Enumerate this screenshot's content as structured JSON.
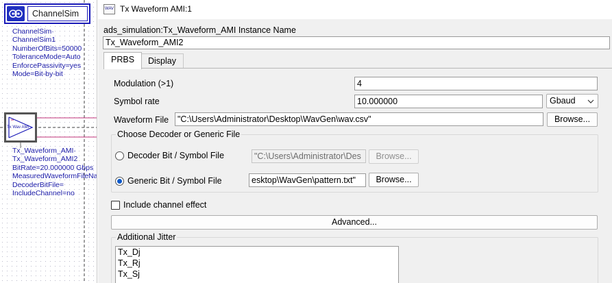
{
  "schematic": {
    "channelsim": {
      "label": "ChannelSim",
      "params": [
        "ChannelSim·",
        "ChannelSim1",
        "NumberOfBits=50000",
        "ToleranceMode=Auto",
        "EnforcePassivity=yes",
        "Mode=Bit-by-bit"
      ]
    },
    "tx_block": {
      "symbol_text": "Tx Wav AMI",
      "params": [
        "Tx_Waveform_AMI·",
        "Tx_Waveform_AMI2",
        "BitRate=20.000000 Gbps",
        "MeasuredWaveformFileNa",
        "DecoderBitFile=",
        "IncludeChannel=no"
      ]
    }
  },
  "dialog": {
    "title": "Tx Waveform AMI:1",
    "instance_label": "ads_simulation:Tx_Waveform_AMI Instance Name",
    "instance_name": "Tx_Waveform_AMI2",
    "tabs": [
      {
        "label": "PRBS",
        "active": true
      },
      {
        "label": "Display",
        "active": false
      }
    ],
    "prbs": {
      "modulation": {
        "label": "Modulation (>1)",
        "value": "4"
      },
      "symbol_rate": {
        "label": "Symbol rate",
        "value": "10.000000",
        "unit": "Gbaud"
      },
      "waveform_file": {
        "label": "Waveform File",
        "value": "\"C:\\Users\\Administrator\\Desktop\\WavGen\\wav.csv\"",
        "browse": "Browse..."
      },
      "decoder_group": {
        "title": "Choose Decoder or Generic File",
        "decoder": {
          "label": "Decoder Bit / Symbol File",
          "value": "\"C:\\Users\\Administrator\\Des",
          "browse": "Browse...",
          "checked": false
        },
        "generic": {
          "label": "Generic Bit / Symbol File",
          "value": "esktop\\WavGen\\pattern.txt\"",
          "browse": "Browse...",
          "checked": true
        }
      },
      "include_channel": {
        "label": "Include channel effect",
        "checked": false
      },
      "advanced": "Advanced...",
      "jitter": {
        "title": "Additional Jitter",
        "items": [
          "Tx_Dj",
          "Tx_Rj",
          "Tx_Sj"
        ]
      }
    }
  },
  "colors": {
    "schematic_text": "#1a1aa8",
    "radio_checked": "#0a58ca",
    "dialog_bg": "#f0f0f0"
  }
}
